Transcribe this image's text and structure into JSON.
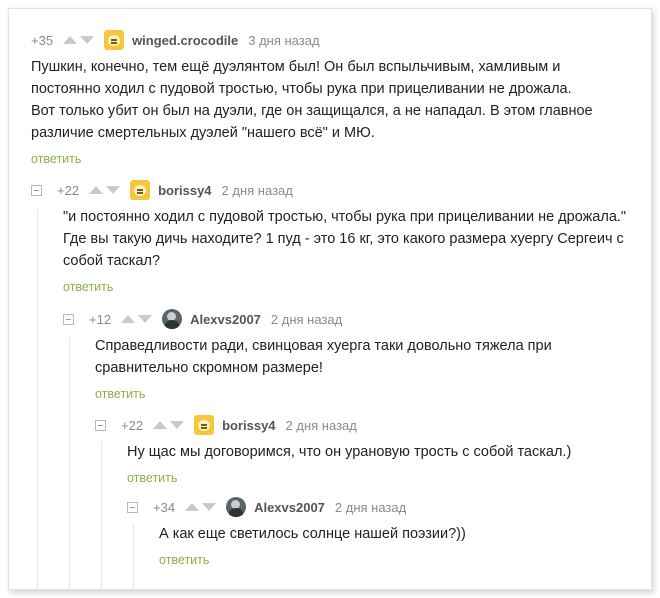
{
  "comments": [
    {
      "rating": "+35",
      "user": "winged.crocodile",
      "date": "3 дня назад",
      "avatar_icon": "yellow-face-avatar-icon",
      "lines": [
        "Пушкин, конечно, тем ещё дуэлянтом был! Он был вспыльчивым, хамливым и",
        "постоянно ходил с пудовой тростью, чтобы рука при прицеливании не дрожала.",
        "Вот только убит он был на дуэли, где он защищался, а не нападал. В этом главное",
        "различие смертельных дуэлей \"нашего всё\" и МЮ."
      ],
      "reply": "ответить"
    },
    {
      "rating": "+22",
      "user": "borissy4",
      "date": "2 дня назад",
      "avatar_icon": "yellow-face-avatar-icon",
      "lines": [
        "\"и постоянно ходил с пудовой тростью, чтобы рука при прицеливании не дрожала.\"",
        "Где вы такую дичь находите? 1 пуд - это 16 кг, это какого размера хуергу Сергеич с",
        "собой таскал?"
      ],
      "reply": "ответить"
    },
    {
      "rating": "+12",
      "user": "Alexvs2007",
      "date": "2 дня назад",
      "avatar_icon": "person-avatar-icon",
      "lines": [
        "Справедливости ради, свинцовая хуерга таки довольно тяжела при",
        "сравнительно скромном размере!"
      ],
      "reply": "ответить"
    },
    {
      "rating": "+22",
      "user": "borissy4",
      "date": "2 дня назад",
      "avatar_icon": "yellow-face-avatar-icon",
      "lines": [
        "Ну щас мы договоримся, что он урановую трость с собой таскал.)"
      ],
      "reply": "ответить"
    },
    {
      "rating": "+34",
      "user": "Alexvs2007",
      "date": "2 дня назад",
      "avatar_icon": "person-avatar-icon",
      "lines": [
        "А как еще светилось солнце нашей поэзии?))"
      ],
      "reply": "ответить"
    }
  ]
}
